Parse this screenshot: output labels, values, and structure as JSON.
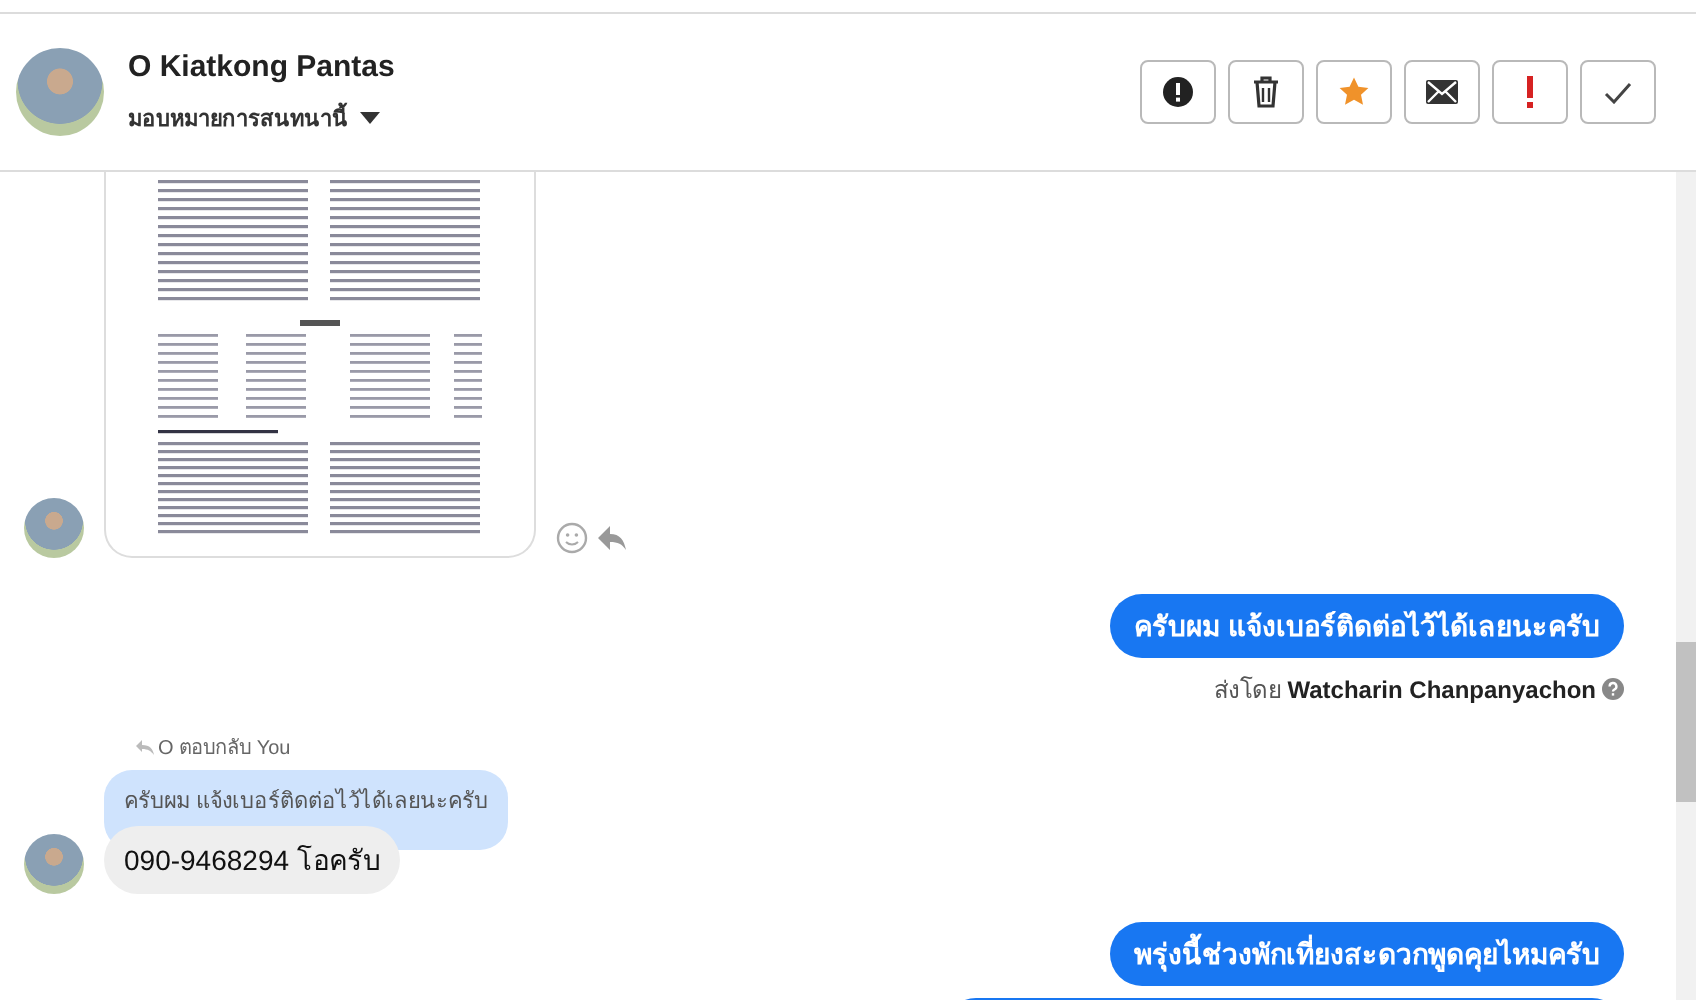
{
  "header": {
    "name": "O Kiatkong Pantas",
    "assign_label": "มอบหมายการสนทนานี้"
  },
  "actions": [
    {
      "kind": "alert"
    },
    {
      "kind": "trash"
    },
    {
      "kind": "star"
    },
    {
      "kind": "mail"
    },
    {
      "kind": "important"
    },
    {
      "kind": "check"
    }
  ],
  "messages": [
    {
      "kind": "image",
      "outgoing": false
    },
    {
      "kind": "text",
      "outgoing": true,
      "text": "ครับผม แจ้งเบอร์ติดต่อไว้ได้เลยนะครับ",
      "sent_by_label": "ส่งโดย",
      "sender": "Watcharin Chanpanyachon"
    },
    {
      "kind": "reply",
      "outgoing": false,
      "reply_label": "O ตอบกลับ You",
      "quoted": "ครับผม แจ้งเบอร์ติดต่อไว้ได้เลยนะครับ",
      "text": "090-9468294 โอครับ"
    },
    {
      "kind": "text",
      "outgoing": true,
      "text": "พรุ่งนี้ช่วงพักเที่ยงสะดวกพูดคุยไหมครับ"
    },
    {
      "kind": "cut",
      "outgoing": true
    }
  ]
}
